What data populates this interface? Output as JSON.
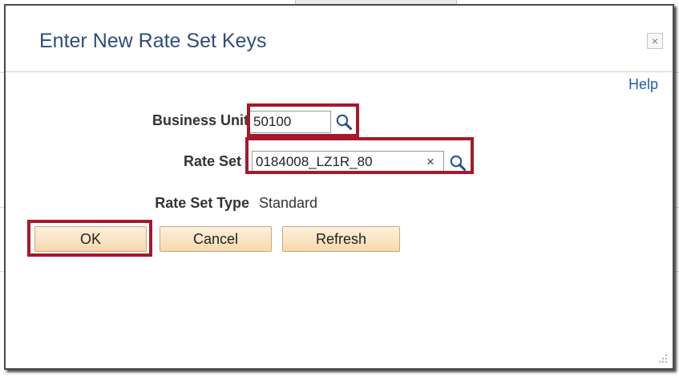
{
  "dialog": {
    "title": "Enter New Rate Set Keys",
    "help_label": "Help",
    "close_label": "×"
  },
  "form": {
    "business_unit": {
      "label": "Business Unit",
      "value": "50100"
    },
    "rate_set": {
      "label": "Rate Set",
      "value": "0184008_LZ1R_80",
      "clear_label": "×"
    },
    "rate_set_type": {
      "label": "Rate Set Type",
      "value": "Standard"
    }
  },
  "buttons": {
    "ok": "OK",
    "cancel": "Cancel",
    "refresh": "Refresh"
  },
  "colors": {
    "title": "#2e4d7c",
    "help_link": "#1f5ea8",
    "highlight": "#a5192b",
    "button_fill": "#f7d9ae"
  }
}
